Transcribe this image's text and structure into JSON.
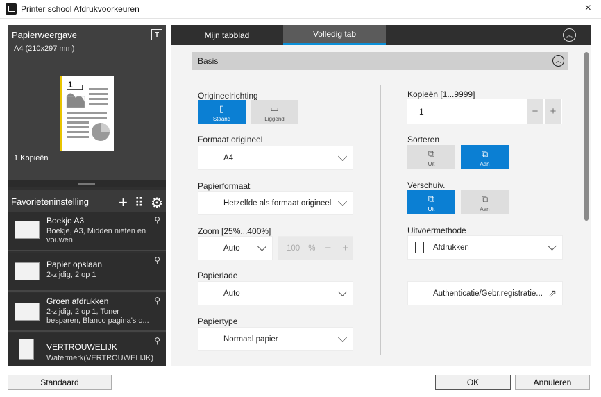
{
  "window": {
    "title": "Printer school Afdrukvoorkeuren",
    "close": "×"
  },
  "preview": {
    "title": "Papierweergave",
    "toggle_icon": "T",
    "paper_size": "A4 (210x297 mm)",
    "page_number": "1",
    "copies": "1 Kopieën"
  },
  "favorites": {
    "title": "Favorieteninstelling",
    "add": "+",
    "grid": "⠿",
    "settings": "⚙",
    "items": [
      {
        "name": "Boekje A3",
        "desc": "Boekje, A3, Midden nieten en vouwen"
      },
      {
        "name": "Papier opslaan",
        "desc": "2-zijdig, 2 op 1"
      },
      {
        "name": "Groen afdrukken",
        "desc": "2-zijdig, 2 op 1, Toner besparen, Blanco pagina's o..."
      },
      {
        "name": "VERTROUWELIJK",
        "desc": "Watermerk(VERTROUWELIJK)"
      }
    ]
  },
  "tabs": [
    {
      "label": "Mijn tabblad",
      "active": false
    },
    {
      "label": "Volledig tab",
      "active": true
    }
  ],
  "section": {
    "title": "Basis"
  },
  "orientation": {
    "label": "Origineelrichting",
    "options": [
      {
        "label": "Staand",
        "selected": true
      },
      {
        "label": "Liggend",
        "selected": false
      }
    ]
  },
  "original_size": {
    "label": "Formaat origineel",
    "value": "A4"
  },
  "paper_size": {
    "label": "Papierformaat",
    "value": "Hetzelfde als formaat origineel"
  },
  "zoom": {
    "label": "Zoom [25%...400%]",
    "mode": "Auto",
    "value": "100",
    "unit": "%",
    "minus": "−",
    "plus": "+"
  },
  "tray": {
    "label": "Papierlade",
    "value": "Auto"
  },
  "paper_type": {
    "label": "Papiertype",
    "value": "Normaal papier"
  },
  "copies": {
    "label": "Kopieën [1...9999]",
    "value": "1",
    "minus": "−",
    "plus": "+"
  },
  "collate": {
    "label": "Sorteren",
    "options": [
      {
        "label": "Uit",
        "selected": false
      },
      {
        "label": "Aan",
        "selected": true
      }
    ]
  },
  "offset": {
    "label": "Verschuiv.",
    "options": [
      {
        "label": "Uit",
        "selected": true
      },
      {
        "label": "Aan",
        "selected": false
      }
    ]
  },
  "output_method": {
    "label": "Uitvoermethode",
    "value": "Afdrukken"
  },
  "authentication": {
    "label": "Authenticatie/Gebr.registratie..."
  },
  "footer": {
    "default": "Standaard",
    "ok": "OK",
    "cancel": "Annuleren"
  },
  "colors": {
    "accent": "#0b7fd3",
    "dark_panel": "#303030",
    "tab_active": "#5b5b5b"
  }
}
